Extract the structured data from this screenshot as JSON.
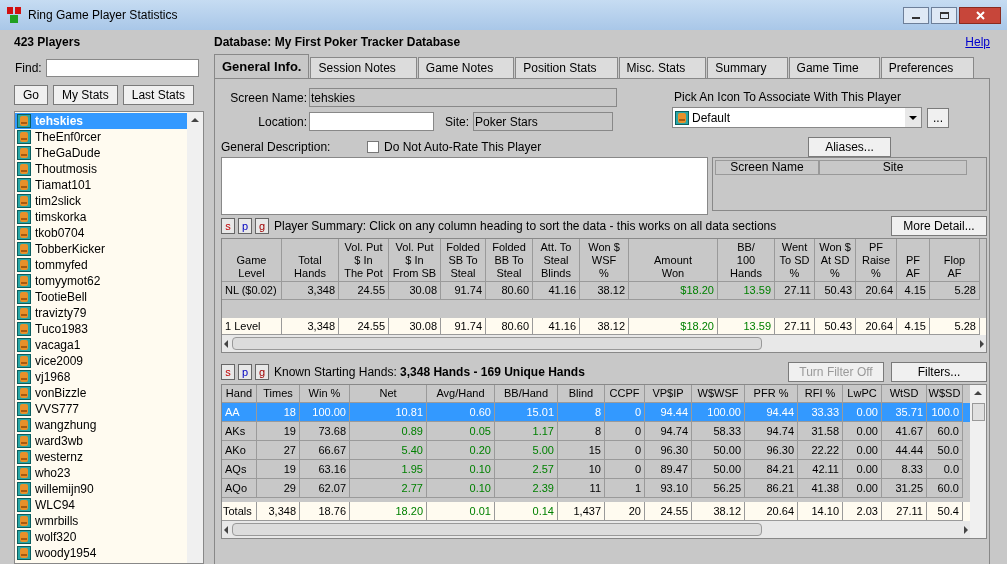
{
  "window": {
    "title": "Ring Game Player Statistics"
  },
  "players_panel": {
    "count": "423 Players",
    "find_label": "Find:",
    "buttons": [
      "Go",
      "My Stats",
      "Last Stats"
    ],
    "players": [
      {
        "name": "tehskies",
        "selected": true
      },
      {
        "name": "TheEnf0rcer",
        "selected": false
      },
      {
        "name": "TheGaDude",
        "selected": false
      },
      {
        "name": "Thoutmosis",
        "selected": false
      },
      {
        "name": "Tiamat101",
        "selected": false
      },
      {
        "name": "tim2slick",
        "selected": false
      },
      {
        "name": "timskorka",
        "selected": false
      },
      {
        "name": "tkob0704",
        "selected": false
      },
      {
        "name": "TobberKicker",
        "selected": false
      },
      {
        "name": "tommyfed",
        "selected": false
      },
      {
        "name": "tomyymot62",
        "selected": false
      },
      {
        "name": "TootieBell",
        "selected": false
      },
      {
        "name": "travizty79",
        "selected": false
      },
      {
        "name": "Tuco1983",
        "selected": false
      },
      {
        "name": "vacaga1",
        "selected": false
      },
      {
        "name": "vice2009",
        "selected": false
      },
      {
        "name": "vj1968",
        "selected": false
      },
      {
        "name": "vonBizzle",
        "selected": false
      },
      {
        "name": "VVS777",
        "selected": false
      },
      {
        "name": "wangzhung",
        "selected": false
      },
      {
        "name": "ward3wb",
        "selected": false
      },
      {
        "name": "westernz",
        "selected": false
      },
      {
        "name": "who23",
        "selected": false
      },
      {
        "name": "willemijn90",
        "selected": false
      },
      {
        "name": "WLC94",
        "selected": false
      },
      {
        "name": "wmrbills",
        "selected": false
      },
      {
        "name": "wolf320",
        "selected": false
      },
      {
        "name": "woody1954",
        "selected": false
      }
    ]
  },
  "database": "Database: My First Poker Tracker Database",
  "help_link": "Help",
  "tabs": [
    {
      "label": "General Info.",
      "selected": true
    },
    {
      "label": "Session Notes",
      "selected": false
    },
    {
      "label": "Game Notes",
      "selected": false
    },
    {
      "label": "Position Stats",
      "selected": false
    },
    {
      "label": "Misc. Stats",
      "selected": false
    },
    {
      "label": "Summary",
      "selected": false
    },
    {
      "label": "Game Time",
      "selected": false
    },
    {
      "label": "Preferences",
      "selected": false
    }
  ],
  "general": {
    "screen_name_label": "Screen Name:",
    "screen_name": "tehskies",
    "location_label": "Location:",
    "site_label": "Site:",
    "site": "Poker Stars",
    "icon_label": "Pick An Icon To Associate With This Player",
    "icon_choice": "Default",
    "browse_button": "...",
    "description_label": "General Description:",
    "auto_rate": {
      "label": "Do Not Auto-Rate This Player",
      "checked": false
    },
    "aliases_button": "Aliases...",
    "alias_columns": [
      "Screen Name",
      "Site"
    ]
  },
  "player_summary": {
    "section_buttons": [
      "s",
      "p",
      "g"
    ],
    "caption": "Player Summary: Click on any column heading to sort the data - this works on all data sections",
    "more_button": "More Detail...",
    "columns": [
      {
        "label": "Game\nLevel",
        "money": false
      },
      {
        "label": "Total\nHands",
        "money": false
      },
      {
        "label": "Vol. Put\n$ In\nThe Pot",
        "money": false
      },
      {
        "label": "Vol. Put\n$ In\nFrom SB",
        "money": false
      },
      {
        "label": "Folded\nSB To\nSteal",
        "money": false
      },
      {
        "label": "Folded\nBB To\nSteal",
        "money": false
      },
      {
        "label": "Att. To\nSteal\nBlinds",
        "money": false
      },
      {
        "label": "Won $\nWSF\n%",
        "money": false
      },
      {
        "label": "Amount\nWon",
        "money": true
      },
      {
        "label": "BB/\n100\nHands",
        "money": true
      },
      {
        "label": "Went\nTo SD\n%",
        "money": false
      },
      {
        "label": "Won $\nAt SD\n%",
        "money": false
      },
      {
        "label": "PF\nRaise\n%",
        "money": false
      },
      {
        "label": "PF\nAF",
        "money": false
      },
      {
        "label": "Flop\nAF",
        "money": false
      }
    ],
    "rows": [
      [
        "NL ($0.02)",
        "3,348",
        "24.55",
        "30.08",
        "91.74",
        "80.60",
        "41.16",
        "38.12",
        "$18.20",
        "13.59",
        "27.11",
        "50.43",
        "20.64",
        "4.15",
        "5.28"
      ]
    ],
    "totals": [
      "1 Level",
      "3,348",
      "24.55",
      "30.08",
      "91.74",
      "80.60",
      "41.16",
      "38.12",
      "$18.20",
      "13.59",
      "27.11",
      "50.43",
      "20.64",
      "4.15",
      "5.28"
    ]
  },
  "starting_hands": {
    "section_buttons": [
      "s",
      "p",
      "g"
    ],
    "caption": "Known Starting Hands: **3,348 Hands - 169 Unique Hands**",
    "filter_off_button": {
      "label": "Turn Filter Off",
      "disabled": true
    },
    "filters_button": "Filters...",
    "columns": [
      {
        "label": "Hand",
        "money": false
      },
      {
        "label": "Times",
        "money": false
      },
      {
        "label": "Win %",
        "money": false
      },
      {
        "label": "Net",
        "money": true
      },
      {
        "label": "Avg/Hand",
        "money": true
      },
      {
        "label": "BB/Hand",
        "money": true
      },
      {
        "label": "Blind",
        "money": false
      },
      {
        "label": "CCPF",
        "money": false
      },
      {
        "label": "VP$IP",
        "money": false
      },
      {
        "label": "W$WSF",
        "money": false
      },
      {
        "label": "PFR %",
        "money": false
      },
      {
        "label": "RFI %",
        "money": false
      },
      {
        "label": "LwPC",
        "money": false
      },
      {
        "label": "WtSD",
        "money": false
      },
      {
        "label": "W$SD",
        "money": false
      }
    ],
    "rows": [
      {
        "selected": true,
        "cells": [
          "AA",
          "18",
          "100.00",
          "10.81",
          "0.60",
          "15.01",
          "8",
          "0",
          "94.44",
          "100.00",
          "94.44",
          "33.33",
          "0.00",
          "35.71",
          "100.0"
        ]
      },
      {
        "selected": false,
        "cells": [
          "AKs",
          "19",
          "73.68",
          "0.89",
          "0.05",
          "1.17",
          "8",
          "0",
          "94.74",
          "58.33",
          "94.74",
          "31.58",
          "0.00",
          "41.67",
          "60.0"
        ]
      },
      {
        "selected": false,
        "cells": [
          "AKo",
          "27",
          "66.67",
          "5.40",
          "0.20",
          "5.00",
          "15",
          "0",
          "96.30",
          "50.00",
          "96.30",
          "22.22",
          "0.00",
          "44.44",
          "50.0"
        ]
      },
      {
        "selected": false,
        "cells": [
          "AQs",
          "19",
          "63.16",
          "1.95",
          "0.10",
          "2.57",
          "10",
          "0",
          "89.47",
          "50.00",
          "84.21",
          "42.11",
          "0.00",
          "8.33",
          "0.0"
        ]
      },
      {
        "selected": false,
        "cells": [
          "AQo",
          "29",
          "62.07",
          "2.77",
          "0.10",
          "2.39",
          "11",
          "1",
          "93.10",
          "56.25",
          "86.21",
          "41.38",
          "0.00",
          "31.25",
          "60.0"
        ]
      }
    ],
    "totals": [
      "Totals",
      "3,348",
      "18.76",
      "18.20",
      "0.01",
      "0.14",
      "1,437",
      "20",
      "24.55",
      "38.12",
      "20.64",
      "14.10",
      "2.03",
      "27.11",
      "50.4"
    ]
  }
}
